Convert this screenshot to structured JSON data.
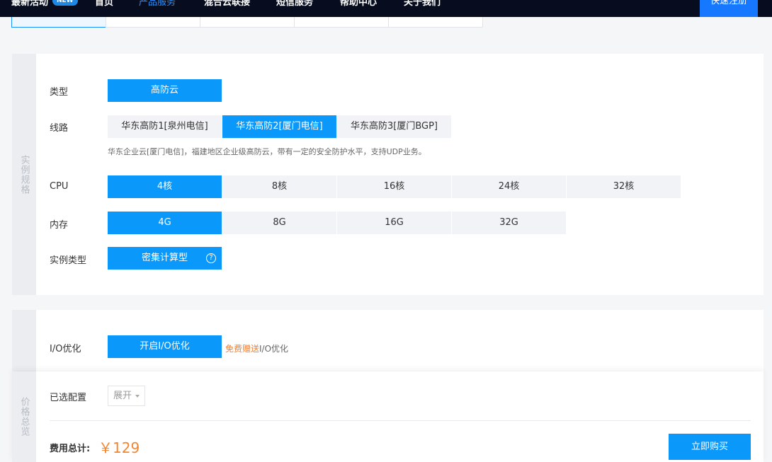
{
  "nav": {
    "activities": "最新活动",
    "new_badge": "NEW",
    "home": "首页",
    "products": "产品服务",
    "cloud_connect": "混合云联接",
    "sms": "短信服务",
    "help": "帮助中心",
    "about": "关于我们",
    "register": "快速注册"
  },
  "spec": {
    "side_label": "实例规格",
    "type": {
      "label": "类型",
      "options": [
        "高防云"
      ],
      "selected": 0
    },
    "line": {
      "label": "线路",
      "options": [
        "华东高防1[泉州电信]",
        "华东高防2[厦门电信]",
        "华东高防3[厦门BGP]"
      ],
      "selected": 1,
      "hint": "华东企业云[厦门电信]，福建地区企业级高防云，带有一定的安全防护水平，支持UDP业务。"
    },
    "cpu": {
      "label": "CPU",
      "options": [
        "4核",
        "8核",
        "16核",
        "24核",
        "32核"
      ],
      "selected": 0
    },
    "memory": {
      "label": "内存",
      "options": [
        "4G",
        "8G",
        "16G",
        "32G"
      ],
      "selected": 0
    },
    "instance_type": {
      "label": "实例类型",
      "options": [
        "密集计算型"
      ],
      "selected": 0,
      "help_icon": "question-circle-icon"
    }
  },
  "io": {
    "label": "I/O优化",
    "option": "开启I/O优化",
    "free_prefix": "免费赠送",
    "free_suffix": "I/O优化"
  },
  "price": {
    "side_label": "价格总览",
    "selected_config_label": "已选配置",
    "expand_label": "展开",
    "total_label": "费用总计:",
    "total_value": "￥129",
    "buy_label": "立即购买"
  },
  "colors": {
    "accent": "#0b98fb",
    "price": "#f5852f",
    "nav_bg": "#070d1f"
  }
}
